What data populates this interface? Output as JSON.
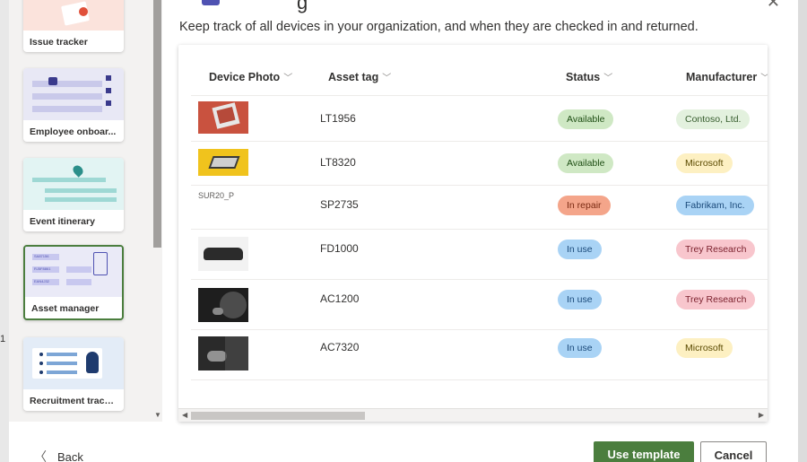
{
  "dialog": {
    "description": "Keep track of all devices in your organization, and when they are checked in and returned.",
    "back_label": "Back",
    "use_template_label": "Use template",
    "cancel_label": "Cancel",
    "title_fragment": "g"
  },
  "templates": [
    {
      "label": "Issue tracker"
    },
    {
      "label": "Employee onboar..."
    },
    {
      "label": "Event itinerary"
    },
    {
      "label": "Asset manager",
      "selected": true
    },
    {
      "label": "Recruitment tracker"
    }
  ],
  "asset_thumb": {
    "tags": [
      "SA87156",
      "RJ5F8861",
      "EAN4J32"
    ]
  },
  "table": {
    "columns": [
      "Device Photo",
      "Asset tag",
      "Status",
      "Manufacturer"
    ],
    "rows": [
      {
        "photo": "red tablet",
        "asset_tag": "LT1956",
        "status": "Available",
        "manufacturer": "Contoso, Ltd."
      },
      {
        "photo": "laptop on yellow",
        "asset_tag": "LT8320",
        "status": "Available",
        "manufacturer": "Microsoft"
      },
      {
        "photo_alt": "SUR20_P",
        "asset_tag": "SP2735",
        "status": "In repair",
        "manufacturer": "Fabrikam, Inc."
      },
      {
        "photo": "keyboard",
        "asset_tag": "FD1000",
        "status": "In use",
        "manufacturer": "Trey Research"
      },
      {
        "photo": "dark device",
        "asset_tag": "AC1200",
        "status": "In use",
        "manufacturer": "Trey Research"
      },
      {
        "photo": "dark mouse",
        "asset_tag": "AC7320",
        "status": "In use",
        "manufacturer": "Microsoft"
      }
    ]
  },
  "colors": {
    "status_available": "#cfe8c4",
    "status_in_repair": "#f4a58a",
    "status_in_use": "#a9d3f5",
    "mfr_contoso": "#e3f1de",
    "mfr_microsoft": "#fdf0c2",
    "mfr_fabrikam": "#a9d3f5",
    "mfr_trey": "#f8c6cd",
    "accent_green": "#4b7e3e"
  },
  "background": {
    "left_fragment": "1"
  }
}
